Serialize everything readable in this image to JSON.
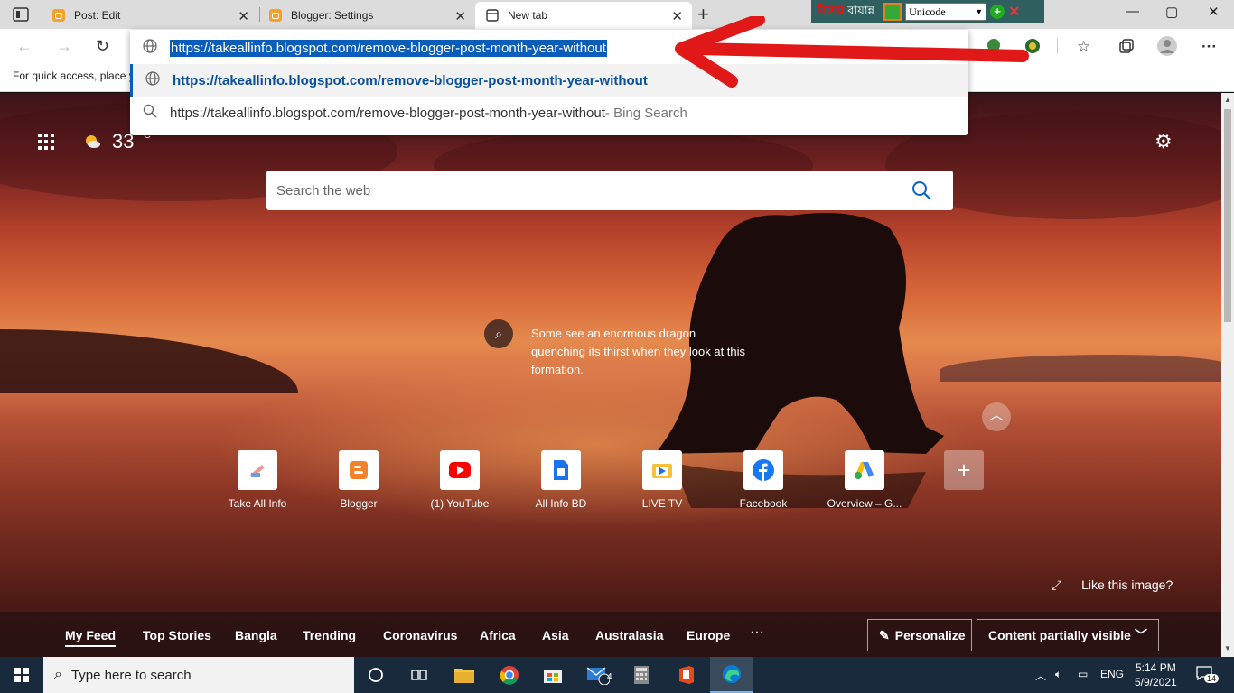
{
  "tabs": [
    {
      "title": "Post: Edit",
      "close": "✕"
    },
    {
      "title": "Blogger: Settings",
      "close": "✕"
    },
    {
      "title": "New tab",
      "close": "✕"
    }
  ],
  "ime": {
    "bangla_label": "বিজয়",
    "bangla_label2": "বায়ান্ন",
    "encoding": "Unicode"
  },
  "window": {
    "minimize": "—",
    "maximize": "▢",
    "close": "✕"
  },
  "address": {
    "input_text": "https://takeallinfo.blogspot.com/remove-blogger-post-month-year-without",
    "suggestion_url": "https://takeallinfo.blogspot.com/remove-blogger-post-month-year-without",
    "suggestion_search": "https://takeallinfo.blogspot.com/remove-blogger-post-month-year-without",
    "suggestion_search_suffix": " - Bing Search"
  },
  "bookmarks": {
    "hint": "For quick access, place y"
  },
  "ntp": {
    "temperature": "33",
    "temp_unit": "°C",
    "search_placeholder": "Search the web",
    "image_info": "Some see an enormous dragon quenching its thirst when they look at this formation.",
    "like_image": "Like this image?",
    "tiles": [
      {
        "label": "Take All Info"
      },
      {
        "label": "Blogger"
      },
      {
        "label": "(1) YouTube"
      },
      {
        "label": "All Info BD"
      },
      {
        "label": "LIVE TV"
      },
      {
        "label": "Facebook"
      },
      {
        "label": "Overview – G..."
      }
    ],
    "add_tile": "+"
  },
  "feed": {
    "tabs": [
      "My Feed",
      "Top Stories",
      "Bangla",
      "Trending",
      "Coronavirus",
      "Africa",
      "Asia",
      "Australasia",
      "Europe"
    ],
    "more": "···",
    "personalize": "Personalize",
    "content_visibility": "Content partially visible"
  },
  "taskbar": {
    "search_placeholder": "Type here to search",
    "mail_badge": "4",
    "language": "ENG",
    "time": "5:14 PM",
    "date": "5/9/2021",
    "notifications": "14"
  },
  "colors": {
    "accent": "#0a5db8",
    "arrow": "#e01818"
  }
}
